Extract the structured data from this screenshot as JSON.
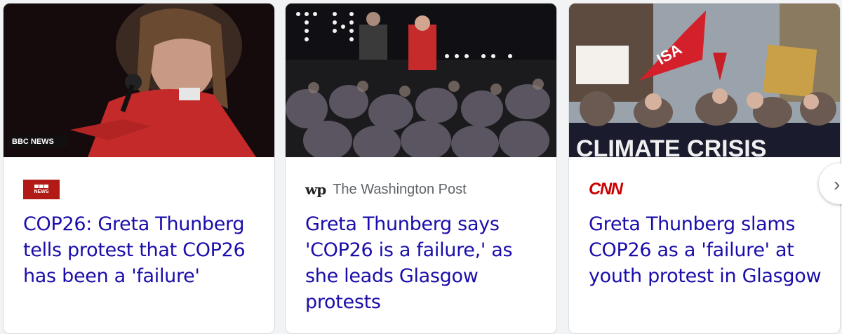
{
  "cards": [
    {
      "source_name": "",
      "logo_text": "NEWS",
      "overlay_logo": "BBC NEWS",
      "headline": "COP26: Greta Thunberg tells protest that COP26 has been a 'failure'"
    },
    {
      "source_name": "The Washington Post",
      "logo_text": "wp",
      "headline": "Greta Thunberg says 'COP26 is a failure,' as she leads Glasgow protests"
    },
    {
      "source_name": "",
      "logo_text": "CNN",
      "headline": "Greta Thunberg slams COP26 as a 'failure' at youth protest in Glasgow"
    }
  ],
  "next_button": {
    "icon": "chevron-right-icon",
    "glyph": "›"
  },
  "colors": {
    "headline": "#1a0dab",
    "source": "#5f6368",
    "bbc_red": "#b21a15",
    "cnn_red": "#cc0000"
  }
}
